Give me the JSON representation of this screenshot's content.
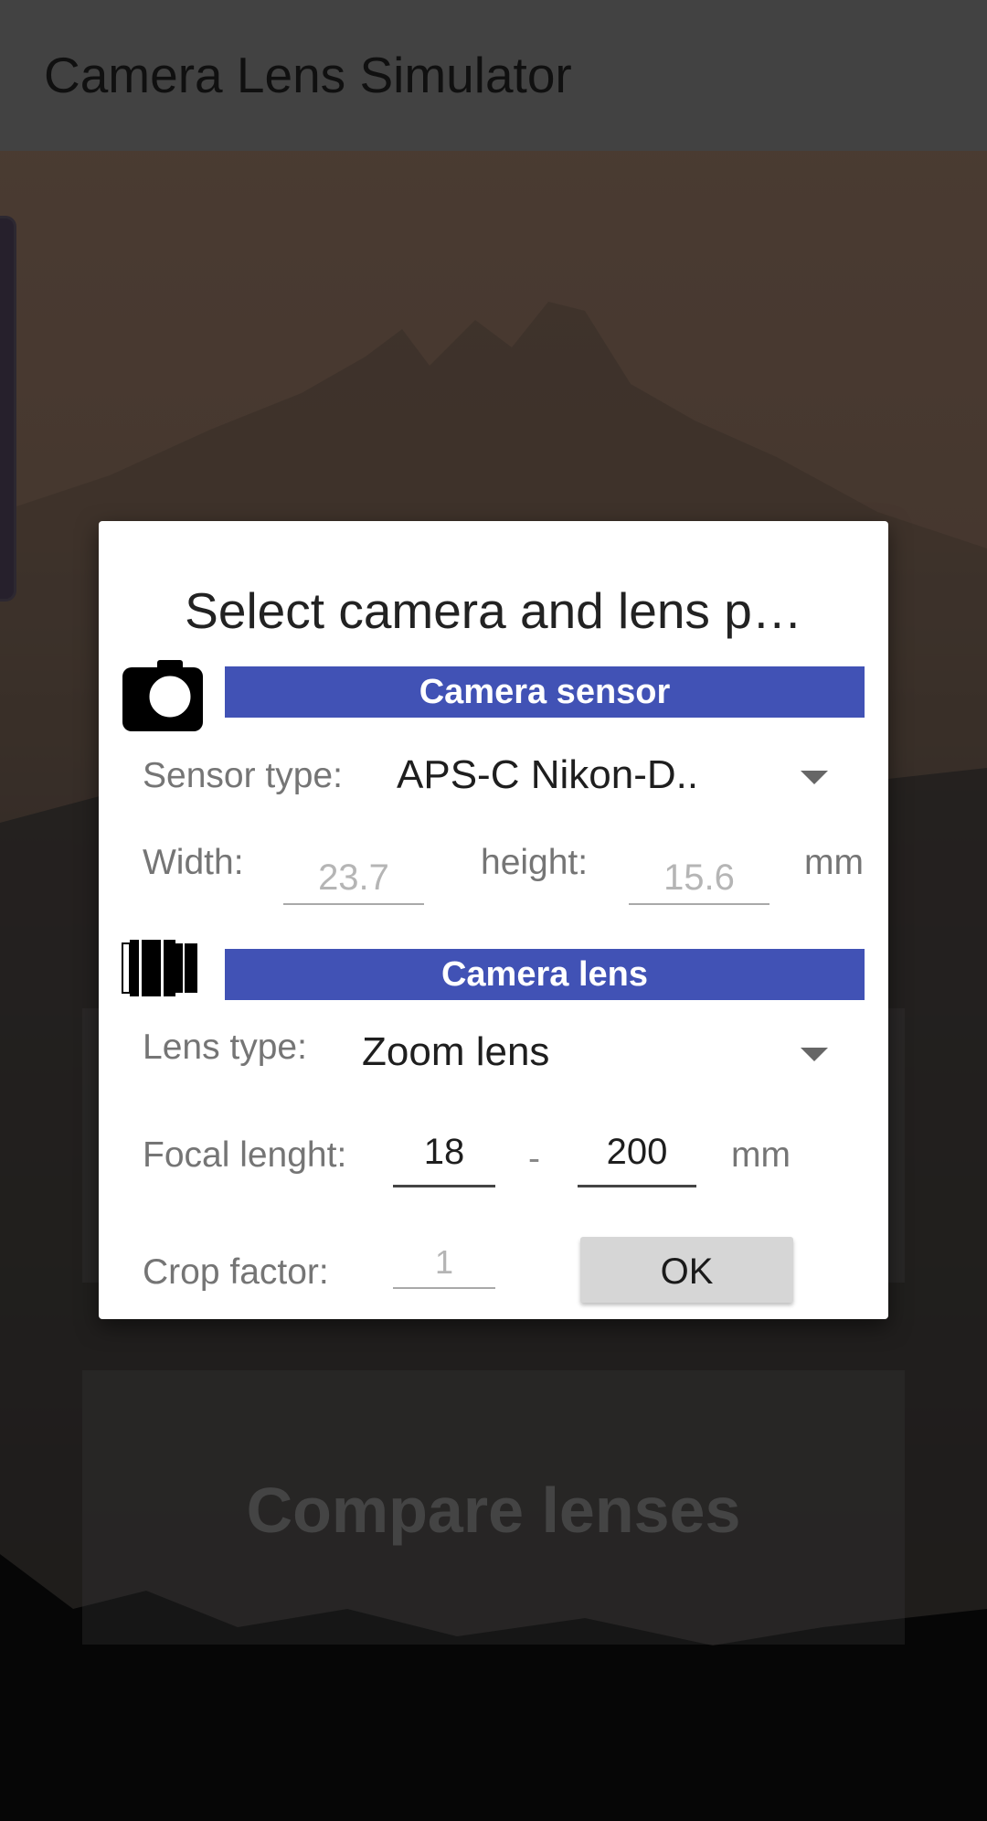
{
  "app": {
    "title": "Camera Lens Simulator"
  },
  "background": {
    "compare_button_label": "Compare lenses"
  },
  "dialog": {
    "title": "Select camera and lens p…",
    "camera_sensor": {
      "section_label": "Camera sensor",
      "sensor_type_label": "Sensor type:",
      "sensor_type_value": "APS-C Nikon-D..",
      "width_label": "Width:",
      "width_value": "23.7",
      "height_label": "height:",
      "height_value": "15.6",
      "unit": "mm"
    },
    "camera_lens": {
      "section_label": "Camera lens",
      "lens_type_label": "Lens type:",
      "lens_type_value": "Zoom lens",
      "focal_label": "Focal lenght:",
      "focal_min": "18",
      "separator": "-",
      "focal_max": "200",
      "unit": "mm",
      "crop_label": "Crop factor:",
      "crop_value": "1"
    },
    "ok_label": "OK"
  },
  "colors": {
    "section_bar": "#4152b5",
    "app_bar": "#6b6b6b",
    "ok_button": "#d6d6d6"
  },
  "icons": {
    "sensor": "camera-icon",
    "lens": "lens-icon",
    "dropdown": "dropdown-arrow-icon"
  }
}
